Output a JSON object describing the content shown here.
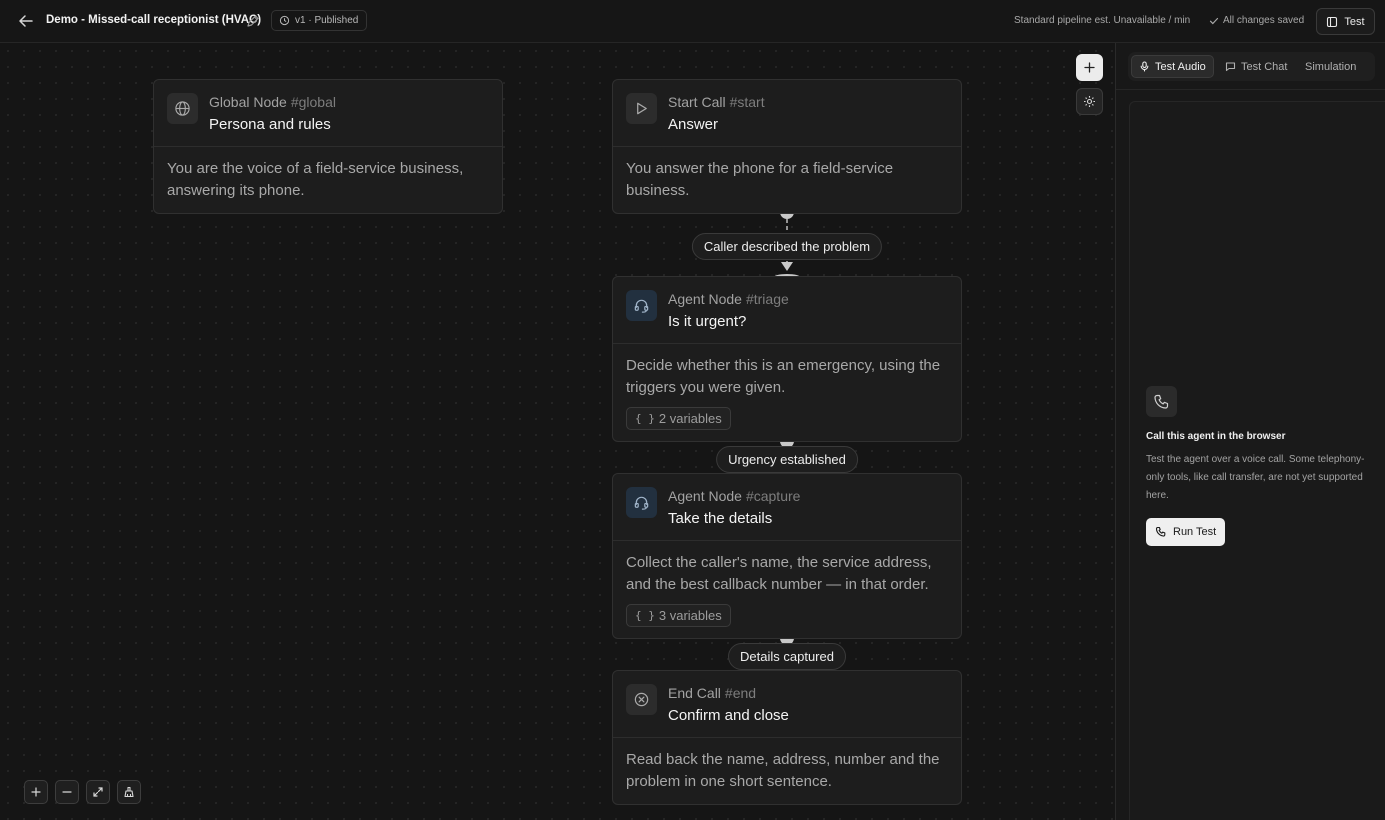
{
  "header": {
    "back_icon": "arrow-left-icon",
    "agent_title": "Demo - Missed-call receptionist (HVAC)",
    "version_badge": "v1 · Published",
    "pipeline_estimate": "Standard pipeline est. Unavailable / min",
    "save_status": "All changes saved",
    "test_button": "Test"
  },
  "nodes": [
    {
      "type": "Global Node",
      "tag": "#global",
      "title": "Persona and rules",
      "icon": "globe-icon",
      "body": "You are the voice of a field-service business, answering its phone.",
      "variables": ""
    },
    {
      "type": "Start Call",
      "tag": "#start",
      "title": "Answer",
      "icon": "play-icon",
      "body": "You answer the phone for a field-service business.",
      "variables": ""
    },
    {
      "type": "Agent Node",
      "tag": "#triage",
      "title": "Is it urgent?",
      "icon": "headset-icon",
      "body": "Decide whether this is an emergency, using the triggers you were given.",
      "variables": "2 variables"
    },
    {
      "type": "Agent Node",
      "tag": "#capture",
      "title": "Take the details",
      "icon": "headset-icon",
      "body": "Collect the caller's name, the service address, and the best callback number — in that order.",
      "variables": "3 variables"
    },
    {
      "type": "End Call",
      "tag": "#end",
      "title": "Confirm and close",
      "icon": "x-circle-icon",
      "body": "Read back the name, address, number and the problem in one short sentence.",
      "variables": ""
    }
  ],
  "edges": [
    {
      "label": "Caller described the problem"
    },
    {
      "label": "Urgency established"
    },
    {
      "label": "Details captured"
    }
  ],
  "canvas_controls": {
    "add_node_icon": "plus-icon",
    "settings_icon": "gear-icon",
    "zoom_in_icon": "plus-icon",
    "zoom_out_icon": "minus-icon",
    "fit_view_icon": "expand-icon",
    "tidy_icon": "broom-icon"
  },
  "test_panel": {
    "tabs": [
      {
        "label": "Test Audio",
        "icon": "mic-icon",
        "active": true
      },
      {
        "label": "Test Chat",
        "icon": "chat-icon",
        "active": false
      },
      {
        "label": "Simulation",
        "icon": "",
        "active": false
      }
    ],
    "call_title": "Call this agent in the browser",
    "call_description": "Test the agent over a voice call. Some telephony-only tools, like call transfer, are not yet supported here.",
    "run_button": "Run Test"
  }
}
